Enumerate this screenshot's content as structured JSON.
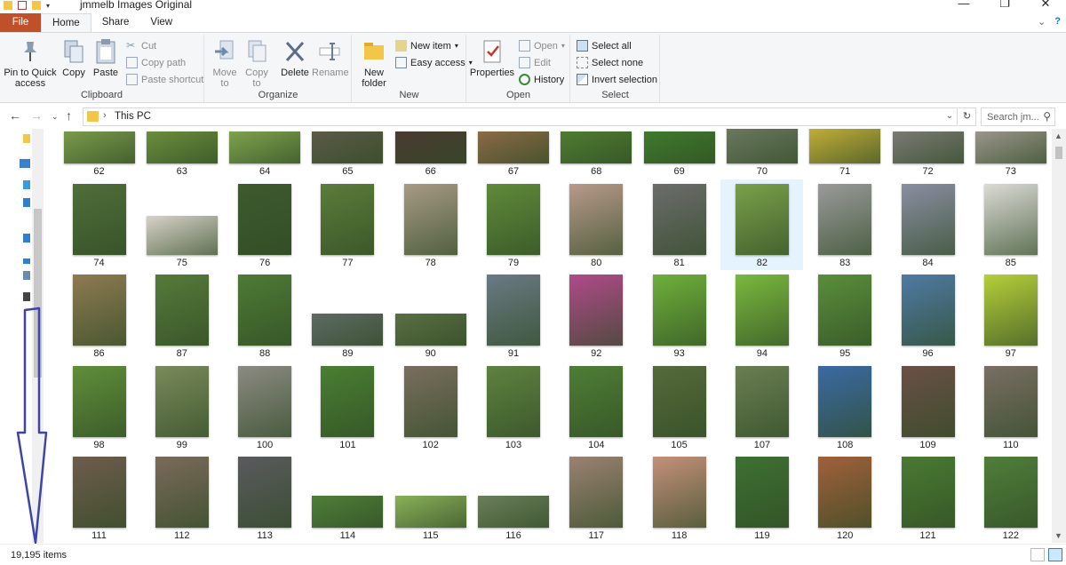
{
  "window": {
    "title": "jmmelb Images Original",
    "controls": [
      "—",
      "❐",
      "✕"
    ]
  },
  "ribbon": {
    "tabs": [
      "File",
      "Home",
      "Share",
      "View"
    ],
    "clipboard": {
      "label": "Clipboard",
      "pin": "Pin to Quick access",
      "copy": "Copy",
      "paste": "Paste",
      "cut": "Cut",
      "copy_path": "Copy path",
      "paste_shortcut": "Paste shortcut"
    },
    "organize": {
      "label": "Organize",
      "move_to": "Move to",
      "copy_to": "Copy to",
      "delete": "Delete",
      "rename": "Rename"
    },
    "new": {
      "label": "New",
      "new_folder": "New folder",
      "new_item": "New item",
      "easy_access": "Easy access"
    },
    "open": {
      "label": "Open",
      "properties": "Properties",
      "open": "Open",
      "edit": "Edit",
      "history": "History"
    },
    "select": {
      "label": "Select",
      "select_all": "Select all",
      "select_none": "Select none",
      "invert": "Invert selection"
    }
  },
  "address": {
    "crumb": "This PC",
    "search_placeholder": "Search jm..."
  },
  "status": {
    "item_count": "19,195 items"
  },
  "files": [
    {
      "label": "62",
      "row": 0,
      "col": 0,
      "fill": "#7a9a4a",
      "shape": "land"
    },
    {
      "label": "63",
      "row": 0,
      "col": 1,
      "fill": "#6a8e3c",
      "shape": "land"
    },
    {
      "label": "64",
      "row": 0,
      "col": 2,
      "fill": "#7da24d",
      "shape": "land"
    },
    {
      "label": "65",
      "row": 0,
      "col": 3,
      "fill": "#5c5a46",
      "shape": "land"
    },
    {
      "label": "66",
      "row": 0,
      "col": 4,
      "fill": "#4a3a32",
      "shape": "land"
    },
    {
      "label": "67",
      "row": 0,
      "col": 5,
      "fill": "#8a6a46",
      "shape": "land"
    },
    {
      "label": "68",
      "row": 0,
      "col": 6,
      "fill": "#4e7c30",
      "shape": "land"
    },
    {
      "label": "69",
      "row": 0,
      "col": 7,
      "fill": "#3f7a2c",
      "shape": "land"
    },
    {
      "label": "70",
      "row": 0,
      "col": 8,
      "fill": "#6e7a62",
      "shape": "wide"
    },
    {
      "label": "71",
      "row": 0,
      "col": 9,
      "fill": "#c9b23a",
      "shape": "wide"
    },
    {
      "label": "72",
      "row": 0,
      "col": 10,
      "fill": "#7b7a74",
      "shape": "land"
    },
    {
      "label": "73",
      "row": 0,
      "col": 11,
      "fill": "#9b958a",
      "shape": "land"
    },
    {
      "label": "74",
      "row": 1,
      "col": 0,
      "fill": "#4f6e3a",
      "shape": "port"
    },
    {
      "label": "75",
      "row": 1,
      "col": 1,
      "fill": "#d8d2c8",
      "shape": "wide"
    },
    {
      "label": "76",
      "row": 1,
      "col": 2,
      "fill": "#3d5a2e",
      "shape": "port"
    },
    {
      "label": "77",
      "row": 1,
      "col": 3,
      "fill": "#5b7c3a",
      "shape": "port"
    },
    {
      "label": "78",
      "row": 1,
      "col": 4,
      "fill": "#a89a86",
      "shape": "port"
    },
    {
      "label": "79",
      "row": 1,
      "col": 5,
      "fill": "#5f8a3a",
      "shape": "port"
    },
    {
      "label": "80",
      "row": 1,
      "col": 6,
      "fill": "#b89a8a",
      "shape": "port"
    },
    {
      "label": "81",
      "row": 1,
      "col": 7,
      "fill": "#6c6c6c",
      "shape": "port"
    },
    {
      "label": "82",
      "row": 1,
      "col": 8,
      "fill": "#7aa04a",
      "shape": "port",
      "selected": true
    },
    {
      "label": "83",
      "row": 1,
      "col": 9,
      "fill": "#9a9a9a",
      "shape": "port"
    },
    {
      "label": "84",
      "row": 1,
      "col": 10,
      "fill": "#8a8ea2",
      "shape": "port"
    },
    {
      "label": "85",
      "row": 1,
      "col": 11,
      "fill": "#dcdbd6",
      "shape": "port"
    },
    {
      "label": "86",
      "row": 2,
      "col": 0,
      "fill": "#8e7a52",
      "shape": "port"
    },
    {
      "label": "87",
      "row": 2,
      "col": 1,
      "fill": "#567a3a",
      "shape": "port"
    },
    {
      "label": "88",
      "row": 2,
      "col": 2,
      "fill": "#4d7a34",
      "shape": "port"
    },
    {
      "label": "89",
      "row": 2,
      "col": 3,
      "fill": "#5e6a64",
      "shape": "land"
    },
    {
      "label": "90",
      "row": 2,
      "col": 4,
      "fill": "#5a6e42",
      "shape": "land"
    },
    {
      "label": "91",
      "row": 2,
      "col": 5,
      "fill": "#6a7a84",
      "shape": "port"
    },
    {
      "label": "92",
      "row": 2,
      "col": 6,
      "fill": "#b04a8a",
      "shape": "port"
    },
    {
      "label": "93",
      "row": 2,
      "col": 7,
      "fill": "#6fb03a",
      "shape": "port"
    },
    {
      "label": "94",
      "row": 2,
      "col": 8,
      "fill": "#7ab83e",
      "shape": "port"
    },
    {
      "label": "95",
      "row": 2,
      "col": 9,
      "fill": "#5a8e3a",
      "shape": "port"
    },
    {
      "label": "96",
      "row": 2,
      "col": 10,
      "fill": "#4f7aa4",
      "shape": "port"
    },
    {
      "label": "97",
      "row": 2,
      "col": 11,
      "fill": "#b6cf3a",
      "shape": "port"
    },
    {
      "label": "98",
      "row": 3,
      "col": 0,
      "fill": "#5f8e3a",
      "shape": "port"
    },
    {
      "label": "99",
      "row": 3,
      "col": 1,
      "fill": "#7a8a5a",
      "shape": "port"
    },
    {
      "label": "100",
      "row": 3,
      "col": 2,
      "fill": "#8c8a82",
      "shape": "port"
    },
    {
      "label": "101",
      "row": 3,
      "col": 3,
      "fill": "#4a7e32",
      "shape": "port"
    },
    {
      "label": "102",
      "row": 3,
      "col": 4,
      "fill": "#7a6e5e",
      "shape": "port"
    },
    {
      "label": "103",
      "row": 3,
      "col": 5,
      "fill": "#5e8240",
      "shape": "port"
    },
    {
      "label": "104",
      "row": 3,
      "col": 6,
      "fill": "#4e7e36",
      "shape": "port"
    },
    {
      "label": "105",
      "row": 3,
      "col": 7,
      "fill": "#566a3a",
      "shape": "port"
    },
    {
      "label": "107",
      "row": 3,
      "col": 8,
      "fill": "#6a7e52",
      "shape": "port"
    },
    {
      "label": "108",
      "row": 3,
      "col": 9,
      "fill": "#3a6aa4",
      "shape": "port"
    },
    {
      "label": "109",
      "row": 3,
      "col": 10,
      "fill": "#6a5046",
      "shape": "port"
    },
    {
      "label": "110",
      "row": 3,
      "col": 11,
      "fill": "#7a6e64",
      "shape": "port"
    },
    {
      "label": "111",
      "row": 4,
      "col": 0,
      "fill": "#6e5c4c",
      "shape": "port"
    },
    {
      "label": "112",
      "row": 4,
      "col": 1,
      "fill": "#7a6a5a",
      "shape": "port"
    },
    {
      "label": "113",
      "row": 4,
      "col": 2,
      "fill": "#5a5a5e",
      "shape": "port"
    },
    {
      "label": "114",
      "row": 4,
      "col": 3,
      "fill": "#4f7e3a",
      "shape": "land"
    },
    {
      "label": "115",
      "row": 4,
      "col": 4,
      "fill": "#8ab05a",
      "shape": "land"
    },
    {
      "label": "116",
      "row": 4,
      "col": 5,
      "fill": "#6a7e5a",
      "shape": "land"
    },
    {
      "label": "117",
      "row": 4,
      "col": 6,
      "fill": "#9a8270",
      "shape": "port"
    },
    {
      "label": "118",
      "row": 4,
      "col": 7,
      "fill": "#c4907a",
      "shape": "port"
    },
    {
      "label": "119",
      "row": 4,
      "col": 8,
      "fill": "#3e7032",
      "shape": "port"
    },
    {
      "label": "120",
      "row": 4,
      "col": 9,
      "fill": "#a0603a",
      "shape": "port"
    },
    {
      "label": "121",
      "row": 4,
      "col": 10,
      "fill": "#4a7a32",
      "shape": "port"
    },
    {
      "label": "122",
      "row": 4,
      "col": 11,
      "fill": "#4f7e3a",
      "shape": "port"
    }
  ]
}
